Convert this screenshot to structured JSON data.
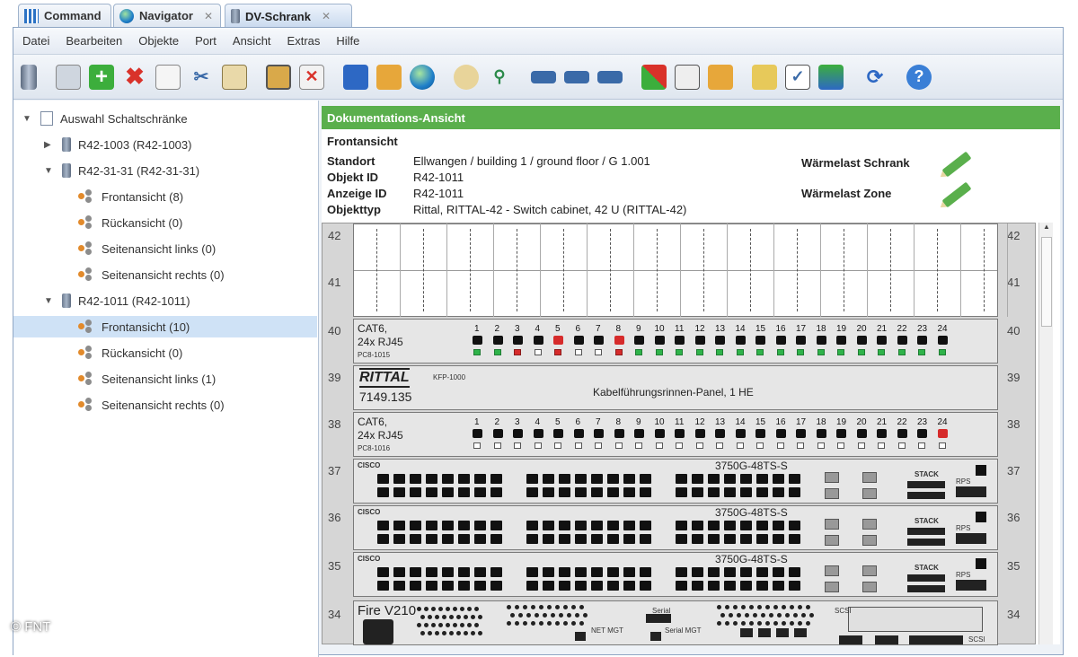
{
  "tabs": [
    {
      "label": "Command",
      "closable": false,
      "active": false
    },
    {
      "label": "Navigator",
      "closable": true,
      "active": false
    },
    {
      "label": "DV-Schrank",
      "closable": true,
      "active": true
    }
  ],
  "menu": [
    "Datei",
    "Bearbeiten",
    "Objekte",
    "Port",
    "Ansicht",
    "Extras",
    "Hilfe"
  ],
  "tree": {
    "root": "Auswahl Schaltschränke",
    "nodes": [
      {
        "label": "R42-1003 (R42-1003)",
        "level": 1,
        "type": "rack",
        "expanded": false
      },
      {
        "label": "R42-31-31 (R42-31-31)",
        "level": 1,
        "type": "rack",
        "expanded": true
      },
      {
        "label": "Frontansicht (8)",
        "level": 2,
        "type": "view"
      },
      {
        "label": "Rückansicht (0)",
        "level": 2,
        "type": "view"
      },
      {
        "label": "Seitenansicht links (0)",
        "level": 2,
        "type": "view"
      },
      {
        "label": "Seitenansicht rechts (0)",
        "level": 2,
        "type": "view"
      },
      {
        "label": "R42-1011 (R42-1011)",
        "level": 1,
        "type": "rack",
        "expanded": true
      },
      {
        "label": "Frontansicht (10)",
        "level": 2,
        "type": "view",
        "selected": true
      },
      {
        "label": "Rückansicht (0)",
        "level": 2,
        "type": "view"
      },
      {
        "label": "Seitenansicht links (1)",
        "level": 2,
        "type": "view"
      },
      {
        "label": "Seitenansicht rechts (0)",
        "level": 2,
        "type": "view"
      }
    ]
  },
  "doc": {
    "title": "Dokumentations-Ansicht",
    "subtitle": "Frontansicht",
    "fields": [
      {
        "key": "Standort",
        "value": "Ellwangen / building 1 / ground floor / G 1.001"
      },
      {
        "key": "Objekt ID",
        "value": "R42-1011"
      },
      {
        "key": "Anzeige ID",
        "value": "R42-1011"
      },
      {
        "key": "Objekttyp",
        "value": "Rittal, RITTAL-42 - Switch cabinet, 42 U (RITTAL-42)"
      }
    ],
    "heat_cabinet": "Wärmelast Schrank",
    "heat_zone": "Wärmelast Zone"
  },
  "rack": {
    "units": [
      "42",
      "41",
      "40",
      "39",
      "38",
      "37",
      "36",
      "35",
      "34"
    ],
    "patch_label_1": "CAT6,",
    "patch_label_2": "24x RJ45",
    "patch40_id": "PC8-1015",
    "patch38_id": "PC8-1016",
    "ports": [
      "1",
      "2",
      "3",
      "4",
      "5",
      "6",
      "7",
      "8",
      "9",
      "10",
      "11",
      "12",
      "13",
      "14",
      "15",
      "16",
      "17",
      "18",
      "19",
      "20",
      "21",
      "22",
      "23",
      "24"
    ],
    "patch40_red_ports": [
      5,
      8
    ],
    "patch40_led_red": [
      3,
      5,
      8
    ],
    "patch40_led_white": [
      4,
      6,
      7
    ],
    "patch38_red_ports": [
      24
    ],
    "brand": "RITTAL",
    "brand_code": "7149.135",
    "panel_model": "KFP-1000",
    "panel_name": "Kabelführungsrinnen-Panel, 1 HE",
    "switch_model": "3750G-48TS-S",
    "switch_brand": "CISCO",
    "stack": "STACK",
    "rps": "RPS",
    "server_name": "Fire V210",
    "serial": "Serial",
    "net_mgt": "NET MGT",
    "serial_mgt": "Serial MGT",
    "scsi": "SCSI"
  },
  "copyright": "© FNT"
}
